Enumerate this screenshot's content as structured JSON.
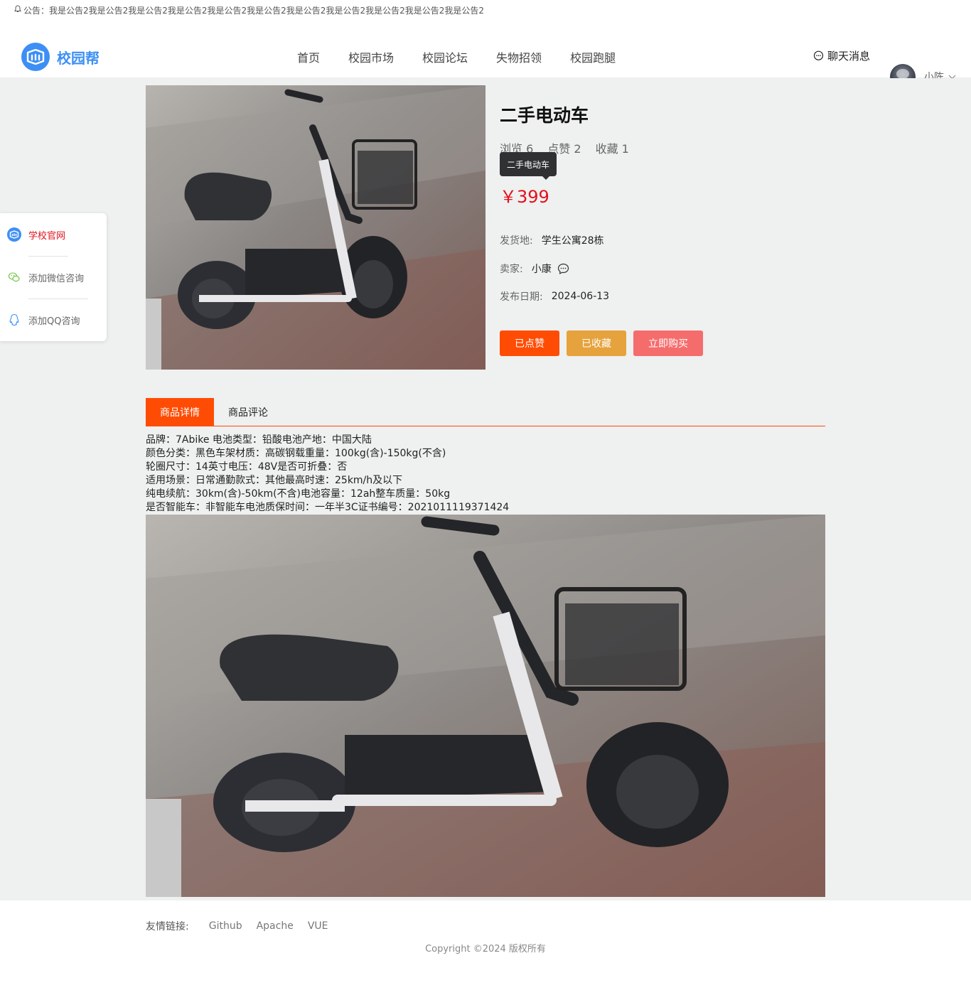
{
  "notice": {
    "icon": "bell-icon",
    "text": "公告：我是公告2我是公告2我是公告2我是公告2我是公告2我是公告2我是公告2我是公告2我是公告2我是公告2我是公告2"
  },
  "header": {
    "logo_text": "校园帮",
    "nav": [
      "首页",
      "校园市场",
      "校园论坛",
      "失物招领",
      "校园跑腿"
    ],
    "chat_label": "聊天消息",
    "user_name": "小陈"
  },
  "side": {
    "items": [
      {
        "label": "学校官网",
        "icon": "school-logo-icon"
      },
      {
        "label": "添加微信咨询",
        "icon": "wechat-icon"
      },
      {
        "label": "添加QQ咨询",
        "icon": "qq-icon"
      }
    ]
  },
  "product": {
    "title": "二手电动车",
    "views": "浏览 6",
    "likes": "点赞 2",
    "favorites": "收藏 1",
    "tooltip": "二手电动车",
    "price": "￥399",
    "ship_label": "发货地:",
    "ship_value": "学生公寓28栋",
    "seller_label": "卖家:",
    "seller_value": "小康",
    "date_label": "发布日期:",
    "date_value": "2024-06-13",
    "buttons": {
      "liked": "已点赞",
      "favorited": "已收藏",
      "buy": "立即购买"
    }
  },
  "colors": {
    "liked": "#ff4c05",
    "favorited": "#e6a23c",
    "buy": "#f56c6c",
    "price": "#e3101c",
    "accent": "#3d8ff5"
  },
  "tabs": [
    "商品详情",
    "商品评论"
  ],
  "specs": [
    "品牌：7Abike 电池类型：铅酸电池产地：中国大陆",
    "颜色分类：黑色车架材质：高碳钢载重量：100kg(含)-150kg(不含)",
    "轮圈尺寸：14英寸电压：48V是否可折叠：否",
    "适用场景：日常通勤款式：其他最高时速：25km/h及以下",
    "纯电续航：30km(含)-50km(不含)电池容量：12ah整车质量：50kg",
    "是否智能车：非智能车电池质保时间：一年半3C证书编号：2021011119371424"
  ],
  "footer": {
    "links_label": "友情链接:",
    "links": [
      "Github",
      "Apache",
      "VUE"
    ],
    "copyright": "Copyright ©2024 版权所有"
  }
}
